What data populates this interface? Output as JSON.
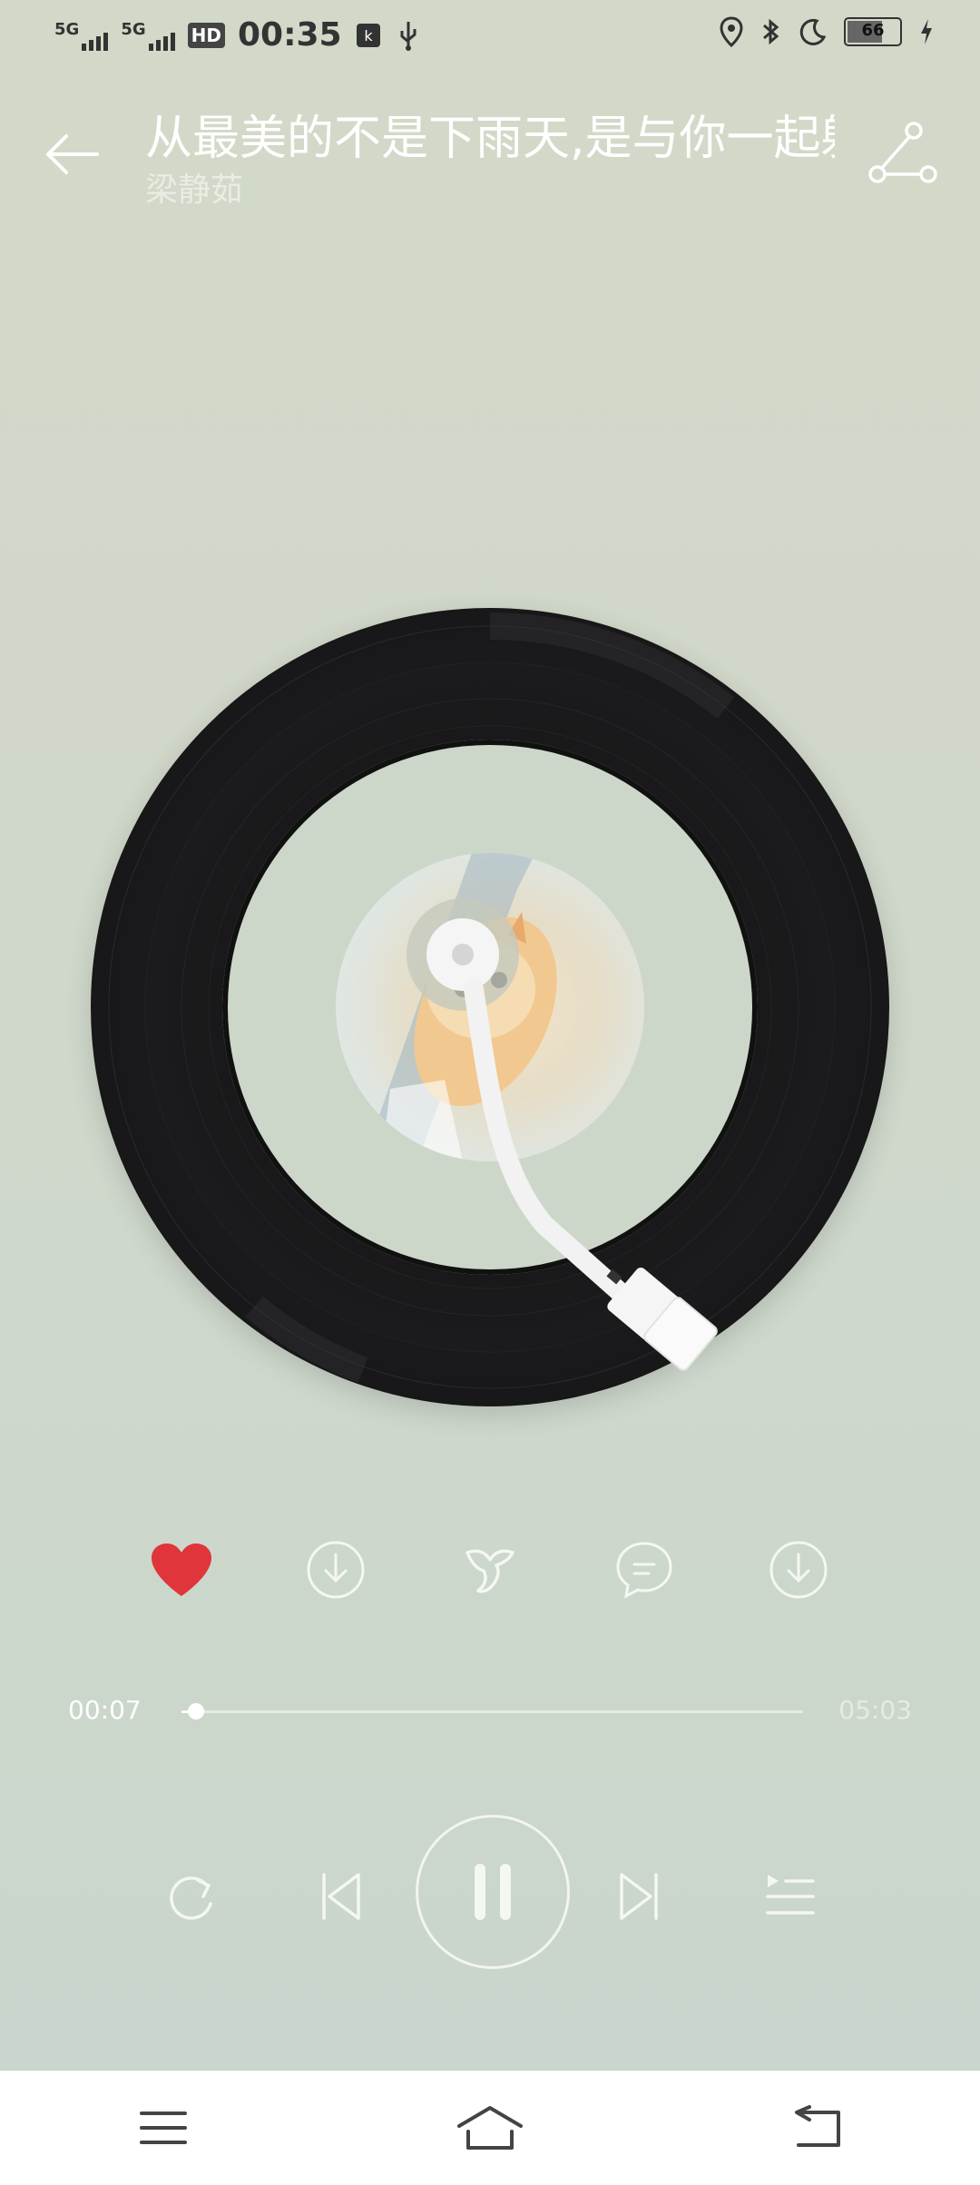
{
  "status_bar": {
    "sim1_label": "5G",
    "sim2_label": "5G",
    "hd_label": "HD",
    "time": "00:35",
    "battery": "66"
  },
  "header": {
    "title": "从最美的不是下雨天,是与你一起躲过雨的屋檐",
    "artist": "梁静茹"
  },
  "actions": [
    {
      "name": "like",
      "icon": "heart-icon",
      "active": true
    },
    {
      "name": "download",
      "icon": "download-icon"
    },
    {
      "name": "effects",
      "icon": "sound-effect-icon"
    },
    {
      "name": "comments",
      "icon": "comment-icon"
    },
    {
      "name": "more",
      "icon": "download-icon"
    }
  ],
  "progress": {
    "current": "00:07",
    "total": "05:03",
    "fraction": 0.023
  },
  "colors": {
    "like_red": "#e0353b",
    "bg_top": "#d3d9c8",
    "bg_bottom": "#c9d6cd"
  }
}
